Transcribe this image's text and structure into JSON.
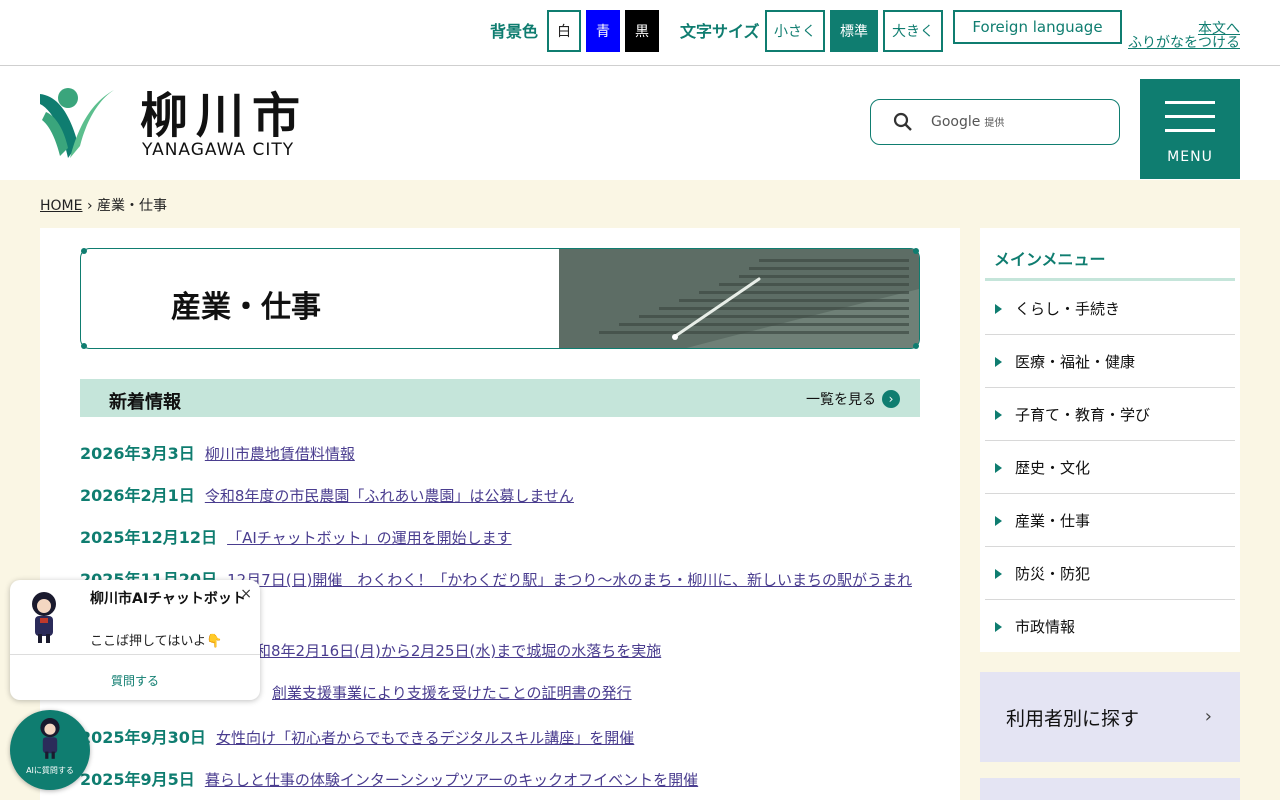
{
  "utility": {
    "bg_label": "背景色",
    "bg_white": "白",
    "bg_blue": "青",
    "bg_black": "黒",
    "size_label": "文字サイズ",
    "size_small": "小さく",
    "size_normal": "標準",
    "size_large": "大きく",
    "foreign": "Foreign language",
    "skip_link": "本文へ",
    "furigana_link": "ふりがなをつける"
  },
  "header": {
    "logo_jp": "柳川市",
    "logo_en": "YANAGAWA CITY",
    "search_provider": "Google",
    "search_provider_suffix": "提供",
    "menu_label": "MENU"
  },
  "breadcrumb": {
    "home": "HOME",
    "sep": "›",
    "current": "産業・仕事"
  },
  "page_title": "産業・仕事",
  "news": {
    "title": "新着情報",
    "more": "一覧を見る",
    "items": [
      {
        "date": "2026年3月3日",
        "title": "柳川市農地賃借料情報"
      },
      {
        "date": "2026年2月1日",
        "title": "令和8年度の市民農園「ふれあい農園」は公募しません"
      },
      {
        "date": "2025年12月12日",
        "title": "「AIチャットボット」の運用を開始します"
      },
      {
        "date": "2025年11月20日",
        "title": "12月7日(日)開催　わくわく！「かわくだり駅」まつり～水のまち・柳川に、新しいまちの駅がうまれ"
      },
      {
        "date": "",
        "title": "和8年2月16日(月)から2月25日(水)まで城堀の水落ちを実施"
      },
      {
        "date": "",
        "title": "創業支援事業により支援を受けたことの証明書の発行"
      },
      {
        "date": "2025年9月30日",
        "title": "女性向け「初心者からでもできるデジタルスキル講座」を開催"
      },
      {
        "date": "2025年9月5日",
        "title": "暮らしと仕事の体験インターンシップツアーのキックオフイベントを開催"
      }
    ]
  },
  "side_nav": {
    "title": "メインメニュー",
    "items": [
      "くらし・手続き",
      "医療・福祉・健康",
      "子育て・教育・学び",
      "歴史・文化",
      "産業・仕事",
      "防災・防犯",
      "市政情報"
    ]
  },
  "user_find": {
    "label": "利用者別に探す",
    "chevron": "›"
  },
  "chatbot": {
    "title": "柳川市AIチャットボット",
    "close": "×",
    "subtitle": "ここば押してはいよ👇",
    "ask": "質問する",
    "fab_label": "AIに質問する"
  },
  "colors": {
    "accent": "#0f7d70",
    "news_header": "#c5e5da",
    "body_bg": "#faf6e4",
    "link": "#4a3d8f"
  }
}
